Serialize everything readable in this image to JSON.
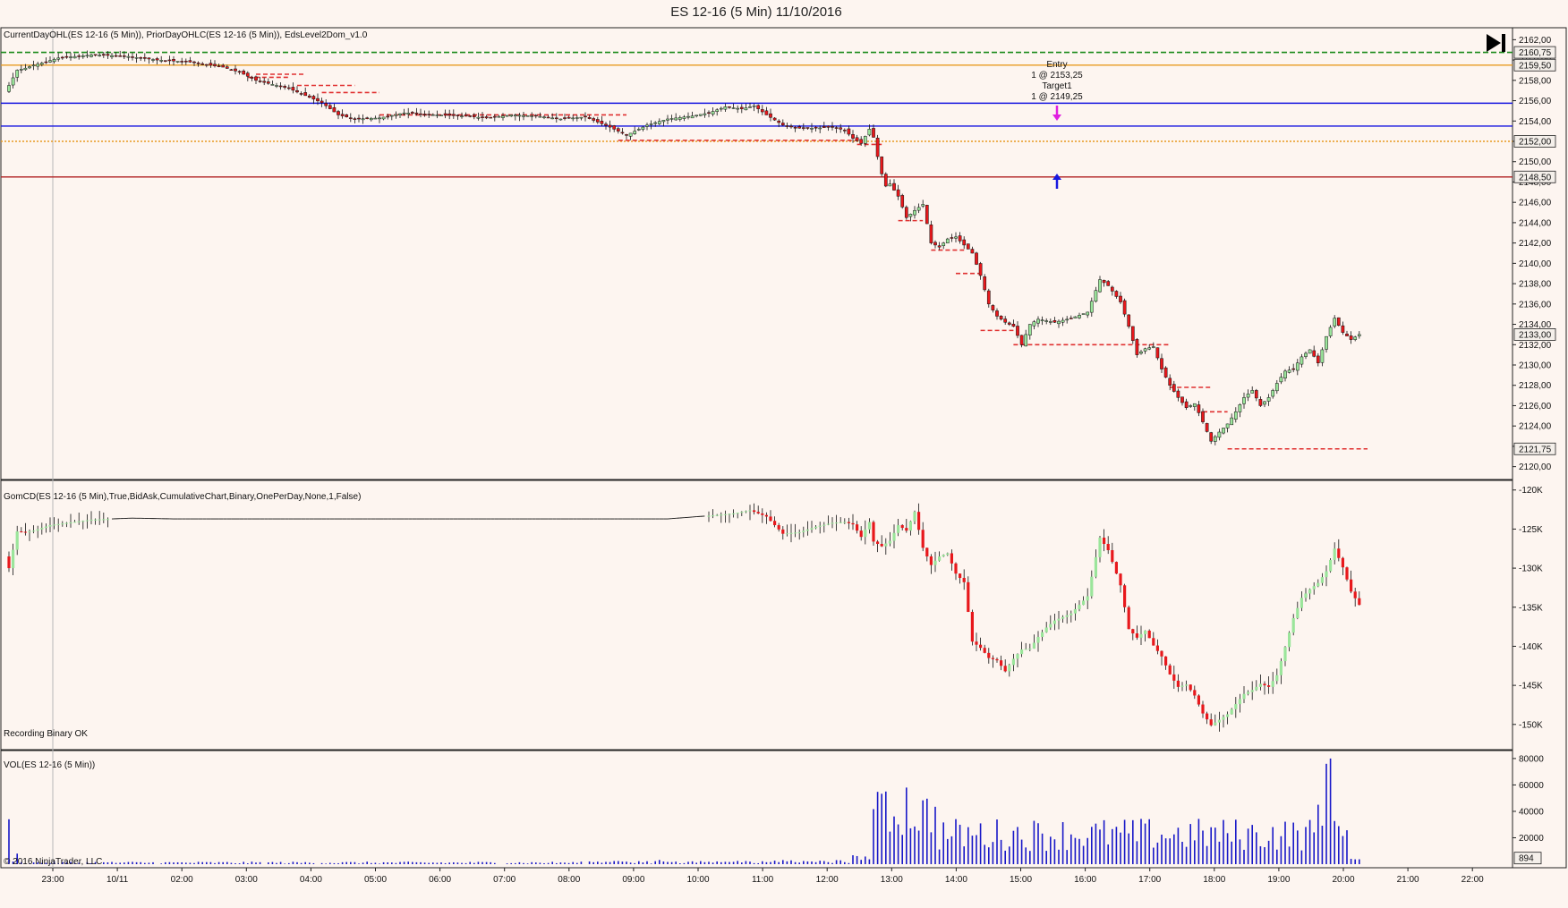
{
  "chart_title": "ES 12-16 (5 Min)  11/10/2016",
  "panels": {
    "price_label": "CurrentDayOHL(ES 12-16 (5 Min)), PriorDayOHLC(ES 12-16 (5 Min)), EdsLevel2Dom_v1.0",
    "delta_label": "GomCD(ES 12-16 (5 Min),True,BidAsk,CumulativeChart,Binary,OnePerDay,None,1,False)",
    "delta_status": "Recording Binary OK",
    "volume_label": "VOL(ES 12-16 (5 Min))",
    "copyright": "© 2016 NinjaTrader, LLC"
  },
  "annotations": {
    "entry_title": "Entry",
    "entry_fill": "1 @ 2153,25",
    "target_title": "Target1",
    "target_fill": "1 @ 2149,25"
  },
  "chart_data": [
    {
      "type": "candlestick",
      "name": "price",
      "y_range": [
        2119,
        2163
      ],
      "y_ticks": [
        "2162,00",
        "2160,00",
        "2158,00",
        "2156,00",
        "2154,00",
        "2152,00",
        "2150,00",
        "2148,00",
        "2146,00",
        "2144,00",
        "2142,00",
        "2140,00",
        "2138,00",
        "2136,00",
        "2134,00",
        "2132,00",
        "2130,00",
        "2128,00",
        "2126,00",
        "2124,00",
        "2122,00",
        "2120,00"
      ],
      "y_tick_values": [
        2162,
        2160,
        2158,
        2156,
        2154,
        2152,
        2150,
        2148,
        2146,
        2144,
        2142,
        2140,
        2138,
        2136,
        2134,
        2132,
        2130,
        2128,
        2126,
        2124,
        2122,
        2120
      ],
      "price_tags": [
        {
          "label": "2160,75",
          "value": 2160.75
        },
        {
          "label": "2159,50",
          "value": 2159.5
        },
        {
          "label": "2152,00",
          "value": 2152.0
        },
        {
          "label": "2148,50",
          "value": 2148.5
        },
        {
          "label": "2133,00",
          "value": 2133.0
        },
        {
          "label": "2121,75",
          "value": 2121.75
        }
      ],
      "levels": [
        {
          "name": "current-day-high",
          "value": 2160.75,
          "color": "#1a8a1a",
          "style": "dashed"
        },
        {
          "name": "prior-day-high",
          "value": 2159.5,
          "color": "#e89a20",
          "style": "solid"
        },
        {
          "name": "prior-close",
          "value": 2152.0,
          "color": "#e89a20",
          "style": "dotted"
        },
        {
          "name": "blue-level-1",
          "value": 2155.75,
          "color": "#1515e0",
          "style": "solid"
        },
        {
          "name": "blue-level-2",
          "value": 2153.5,
          "color": "#1515e0",
          "style": "solid"
        },
        {
          "name": "prior-day-low",
          "value": 2148.5,
          "color": "#b02020",
          "style": "solid"
        }
      ],
      "x_tick_labels": [
        "23:00",
        "10/11",
        "02:00",
        "03:00",
        "04:00",
        "05:00",
        "06:00",
        "07:00",
        "08:00",
        "09:00",
        "10:00",
        "11:00",
        "12:00",
        "13:00",
        "14:00",
        "15:00",
        "16:00",
        "17:00",
        "18:00",
        "19:00",
        "20:00",
        "21:00",
        "22:00"
      ],
      "close_path": [
        [
          0,
          2157.5
        ],
        [
          2,
          2159
        ],
        [
          4,
          2159.2
        ],
        [
          6,
          2159.5
        ],
        [
          8,
          2159.7
        ],
        [
          12,
          2160.2
        ],
        [
          20,
          2160.5
        ],
        [
          28,
          2160.4
        ],
        [
          36,
          2160
        ],
        [
          44,
          2159.8
        ],
        [
          52,
          2159.3
        ],
        [
          56,
          2158.8
        ],
        [
          60,
          2158
        ],
        [
          64,
          2157.6
        ],
        [
          68,
          2157.2
        ],
        [
          72,
          2156.5
        ],
        [
          76,
          2155.8
        ],
        [
          80,
          2154.6
        ],
        [
          84,
          2154.2
        ],
        [
          90,
          2154.3
        ],
        [
          96,
          2154.8
        ],
        [
          104,
          2154.6
        ],
        [
          110,
          2154.5
        ],
        [
          116,
          2154.3
        ],
        [
          122,
          2154.6
        ],
        [
          128,
          2154.5
        ],
        [
          134,
          2154.2
        ],
        [
          140,
          2154.4
        ],
        [
          146,
          2153.4
        ],
        [
          150,
          2152.6
        ],
        [
          155,
          2153.6
        ],
        [
          160,
          2154.2
        ],
        [
          166,
          2154.5
        ],
        [
          170,
          2154.8
        ],
        [
          174,
          2155.4
        ],
        [
          178,
          2155.2
        ],
        [
          181,
          2155.5
        ],
        [
          184,
          2154.6
        ],
        [
          188,
          2153.6
        ],
        [
          192,
          2153.3
        ],
        [
          196,
          2153.3
        ],
        [
          200,
          2153.4
        ],
        [
          203,
          2153.1
        ],
        [
          205,
          2152.3
        ],
        [
          207,
          2151.8
        ],
        [
          209,
          2153.2
        ],
        [
          210,
          2152.4
        ],
        [
          211,
          2150.5
        ],
        [
          212,
          2148.8
        ],
        [
          213,
          2147.6
        ],
        [
          214,
          2147.8
        ],
        [
          216,
          2146.6
        ],
        [
          218,
          2144.5
        ],
        [
          220,
          2145.2
        ],
        [
          222,
          2145.8
        ],
        [
          224,
          2142
        ],
        [
          226,
          2141.6
        ],
        [
          228,
          2142.4
        ],
        [
          230,
          2142.6
        ],
        [
          232,
          2141.8
        ],
        [
          234,
          2141
        ],
        [
          236,
          2138.8
        ],
        [
          238,
          2136
        ],
        [
          240,
          2134.8
        ],
        [
          242,
          2134.2
        ],
        [
          244,
          2133.8
        ],
        [
          246,
          2132
        ],
        [
          248,
          2134
        ],
        [
          250,
          2134.5
        ],
        [
          254,
          2134.2
        ],
        [
          258,
          2134.6
        ],
        [
          262,
          2135.2
        ],
        [
          265,
          2138.4
        ],
        [
          267,
          2137.8
        ],
        [
          270,
          2136.2
        ],
        [
          272,
          2133.8
        ],
        [
          274,
          2131
        ],
        [
          276,
          2131.6
        ],
        [
          278,
          2131.8
        ],
        [
          280,
          2129.6
        ],
        [
          282,
          2128
        ],
        [
          284,
          2126.8
        ],
        [
          286,
          2125.8
        ],
        [
          288,
          2126.2
        ],
        [
          290,
          2124.4
        ],
        [
          292,
          2122.5
        ],
        [
          294,
          2123.4
        ],
        [
          296,
          2124.2
        ],
        [
          298,
          2125.4
        ],
        [
          300,
          2126.8
        ],
        [
          302,
          2127.5
        ],
        [
          304,
          2126
        ],
        [
          306,
          2126.8
        ],
        [
          308,
          2128.2
        ],
        [
          310,
          2129.4
        ],
        [
          312,
          2129.6
        ],
        [
          314,
          2130.8
        ],
        [
          316,
          2131.5
        ],
        [
          318,
          2130.2
        ],
        [
          320,
          2132.8
        ],
        [
          322,
          2134.6
        ],
        [
          324,
          2133.2
        ],
        [
          326,
          2132.5
        ],
        [
          328,
          2133
        ]
      ]
    },
    {
      "type": "candlestick",
      "name": "cumulative-delta",
      "y_range": [
        -153000,
        -119000
      ],
      "y_ticks": [
        "-120K",
        "-125K",
        "-130K",
        "-135K",
        "-140K",
        "-145K",
        "-150K"
      ],
      "y_tick_values": [
        -120000,
        -125000,
        -130000,
        -135000,
        -140000,
        -145000,
        -150000
      ],
      "close_path": [
        [
          0,
          -130000
        ],
        [
          2,
          -125300
        ],
        [
          4,
          -125400
        ],
        [
          6,
          -125200
        ],
        [
          10,
          -124500
        ],
        [
          20,
          -123800
        ],
        [
          30,
          -123600
        ],
        [
          40,
          -123700
        ],
        [
          160,
          -123700
        ],
        [
          170,
          -123300
        ],
        [
          176,
          -123000
        ],
        [
          180,
          -122600
        ],
        [
          184,
          -123400
        ],
        [
          188,
          -125600
        ],
        [
          192,
          -125400
        ],
        [
          196,
          -124700
        ],
        [
          200,
          -124200
        ],
        [
          203,
          -124100
        ],
        [
          205,
          -124400
        ],
        [
          207,
          -126000
        ],
        [
          209,
          -124100
        ],
        [
          210,
          -126600
        ],
        [
          212,
          -127200
        ],
        [
          214,
          -126500
        ],
        [
          216,
          -124500
        ],
        [
          218,
          -125200
        ],
        [
          220,
          -122800
        ],
        [
          222,
          -127400
        ],
        [
          224,
          -129600
        ],
        [
          226,
          -128500
        ],
        [
          228,
          -128100
        ],
        [
          230,
          -130700
        ],
        [
          232,
          -131800
        ],
        [
          234,
          -139400
        ],
        [
          236,
          -140200
        ],
        [
          238,
          -141500
        ],
        [
          240,
          -141800
        ],
        [
          242,
          -143200
        ],
        [
          244,
          -141600
        ],
        [
          246,
          -140400
        ],
        [
          248,
          -140300
        ],
        [
          250,
          -138800
        ],
        [
          252,
          -137600
        ],
        [
          254,
          -136700
        ],
        [
          258,
          -135800
        ],
        [
          262,
          -133600
        ],
        [
          265,
          -126100
        ],
        [
          267,
          -127700
        ],
        [
          270,
          -132200
        ],
        [
          272,
          -137800
        ],
        [
          274,
          -138900
        ],
        [
          276,
          -138000
        ],
        [
          278,
          -139900
        ],
        [
          280,
          -141300
        ],
        [
          282,
          -143600
        ],
        [
          284,
          -145200
        ],
        [
          286,
          -144900
        ],
        [
          288,
          -146300
        ],
        [
          290,
          -148600
        ],
        [
          292,
          -150100
        ],
        [
          294,
          -149400
        ],
        [
          296,
          -148700
        ],
        [
          298,
          -147400
        ],
        [
          300,
          -146100
        ],
        [
          302,
          -145600
        ],
        [
          304,
          -144800
        ],
        [
          306,
          -145200
        ],
        [
          308,
          -143700
        ],
        [
          310,
          -140100
        ],
        [
          312,
          -136400
        ],
        [
          314,
          -133800
        ],
        [
          316,
          -132700
        ],
        [
          318,
          -131900
        ],
        [
          320,
          -130400
        ],
        [
          322,
          -127500
        ],
        [
          324,
          -129900
        ],
        [
          326,
          -133000
        ],
        [
          328,
          -134700
        ]
      ]
    },
    {
      "type": "bar",
      "name": "volume",
      "y_range": [
        0,
        84000
      ],
      "y_ticks": [
        "80000",
        "60000",
        "40000",
        "20000"
      ],
      "y_tick_values": [
        80000,
        60000,
        40000,
        20000
      ],
      "last_value_label": "894",
      "last_value": 894
    }
  ],
  "colors": {
    "up_candle": "#9be59b",
    "down_candle": "#e8181c",
    "wick": "#111111",
    "volume_bar": "#1818c8",
    "support_dash": "#e03030",
    "entry_arrow": "#e020e0",
    "target_arrow": "#1818e0",
    "panel_bg": "#fdf5f0"
  }
}
